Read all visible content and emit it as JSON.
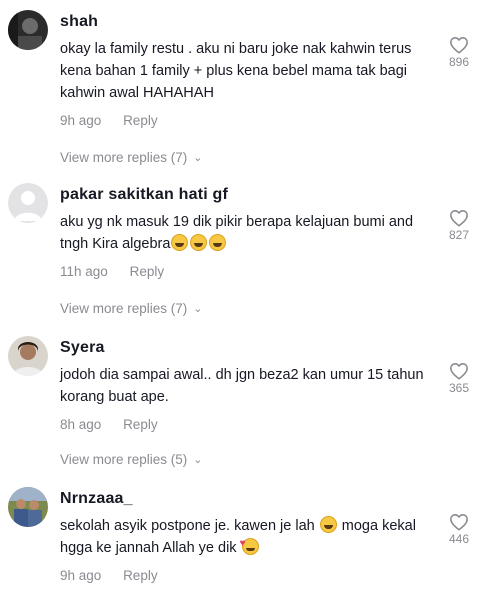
{
  "comments": [
    {
      "username": "shah",
      "text": "okay la family restu . aku ni baru joke nak kahwin terus kena bahan 1 family + plus kena bebel mama tak bagi kahwin awal HAHAHAH",
      "time": "9h ago",
      "reply_label": "Reply",
      "likes": "896",
      "view_replies": "View more replies (7)"
    },
    {
      "username": "pakar sakitkan hati gf",
      "text": "aku yg nk masuk 19 dik pikir berapa kelajuan bumi and tngh Kira algebra",
      "emojis": [
        "grinning-sweat-emoji",
        "grinning-sweat-emoji",
        "grinning-sweat-emoji"
      ],
      "time": "11h ago",
      "reply_label": "Reply",
      "likes": "827",
      "view_replies": "View more replies (7)"
    },
    {
      "username": "Syera",
      "text": "jodoh dia sampai awal.. dh jgn beza2 kan umur 15 tahun korang buat ape.",
      "time": "8h ago",
      "reply_label": "Reply",
      "likes": "365",
      "view_replies": "View more replies (5)"
    },
    {
      "username": "Nrnzaaa_",
      "text_part1": "sekolah asyik postpone je. kawen je lah",
      "text_part2": "moga kekal hgga ke jannah Allah ye dik",
      "emojis": [
        "grinning-sweat-emoji",
        "smiling-hearts-emoji"
      ],
      "time": "9h ago",
      "reply_label": "Reply",
      "likes": "446"
    }
  ],
  "colors": {
    "text": "#161823",
    "muted": "#8a8b91",
    "background": "#ffffff"
  },
  "icons": [
    "heart-outline-icon",
    "chevron-down-icon"
  ]
}
